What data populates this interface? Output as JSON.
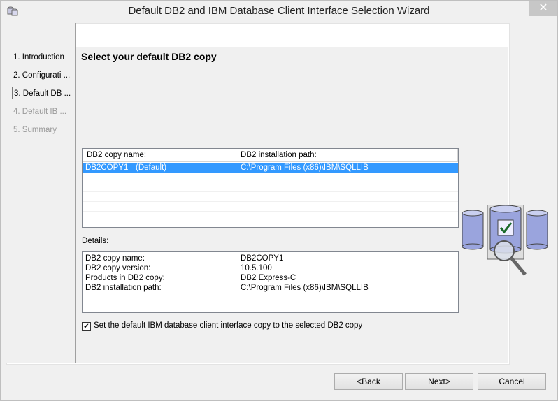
{
  "window": {
    "title": "Default DB2 and IBM Database Client Interface Selection Wizard",
    "close_glyph": "✕"
  },
  "nav": {
    "items": [
      {
        "label": "1. Introduction",
        "state": "enabled"
      },
      {
        "label": "2. Configurati ...",
        "state": "enabled"
      },
      {
        "label": "3. Default DB ...",
        "state": "current"
      },
      {
        "label": "4. Default IB ...",
        "state": "disabled"
      },
      {
        "label": "5. Summary",
        "state": "disabled"
      }
    ]
  },
  "page": {
    "title": "Select your default DB2 copy"
  },
  "copies_table": {
    "columns": [
      "DB2 copy name:",
      "DB2 installation path:"
    ],
    "rows": [
      {
        "name": "DB2COPY1",
        "flag": "(Default)",
        "path": "C:\\Program Files (x86)\\IBM\\SQLLIB",
        "selected": true
      }
    ]
  },
  "details": {
    "label": "Details:",
    "rows": [
      {
        "key": "DB2 copy name:",
        "value": "DB2COPY1"
      },
      {
        "key": "DB2 copy version:",
        "value": "10.5.100"
      },
      {
        "key": "Products in DB2 copy:",
        "value": "DB2 Express-C"
      },
      {
        "key": "DB2 installation path:",
        "value": "C:\\Program Files (x86)\\IBM\\SQLLIB"
      }
    ]
  },
  "option": {
    "checked": true,
    "check_glyph": "✔",
    "label": "Set the default IBM database client interface copy to the selected DB2 copy"
  },
  "buttons": {
    "back": "<Back",
    "next": "Next>",
    "cancel": "Cancel"
  },
  "colors": {
    "selection": "#3399ff",
    "db_cylinder": "#9aa4dd"
  }
}
